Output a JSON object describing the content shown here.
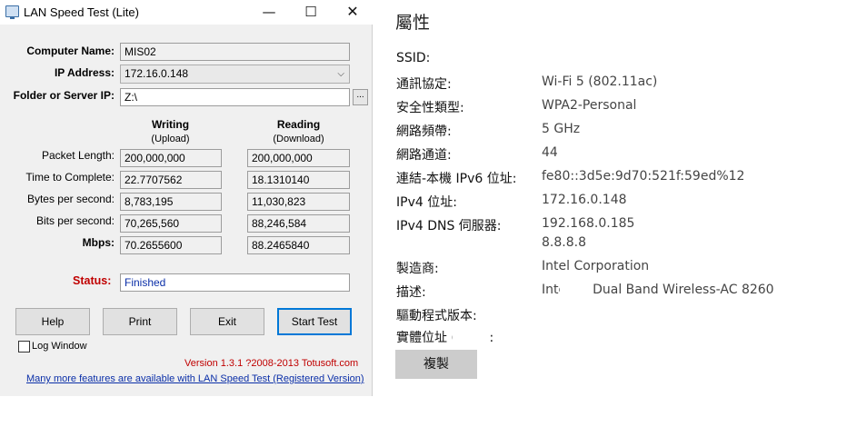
{
  "window": {
    "title": "LAN Speed Test (Lite)",
    "minimize_glyph": "—",
    "maximize_glyph": "☐",
    "close_glyph": "✕"
  },
  "form": {
    "computer_name_label": "Computer Name:",
    "computer_name_value": "MIS02",
    "ip_label": "IP Address:",
    "ip_value": "172.16.0.148",
    "folder_label": "Folder or Server IP:",
    "folder_value": "Z:\\",
    "browse_label": "..."
  },
  "columns": {
    "writing": "Writing",
    "writing_sub": "(Upload)",
    "reading": "Reading",
    "reading_sub": "(Download)"
  },
  "metrics": [
    {
      "label": "Packet Length:",
      "writing": "200,000,000",
      "reading": "200,000,000"
    },
    {
      "label": "Time to Complete:",
      "writing": "22.7707562",
      "reading": "18.1310140"
    },
    {
      "label": "Bytes per second:",
      "writing": "8,783,195",
      "reading": "11,030,823"
    },
    {
      "label": "Bits per second:",
      "writing": "70,265,560",
      "reading": "88,246,584"
    },
    {
      "label": "Mbps:",
      "writing": "70.2655600",
      "reading": "88.2465840"
    }
  ],
  "status": {
    "label": "Status:",
    "value": "Finished"
  },
  "buttons": {
    "help": "Help",
    "print": "Print",
    "exit": "Exit",
    "start": "Start Test"
  },
  "log_window_label": "Log Window",
  "version_text": "Version 1.3.1 ?2008-2013 Totusoft.com",
  "promo_link": "Many more features are available with LAN Speed Test (Registered Version)",
  "properties": {
    "title": "屬性",
    "rows": [
      {
        "key": "SSID:",
        "value": ""
      },
      {
        "key": "通訊協定:",
        "value": "Wi-Fi 5 (802.11ac)"
      },
      {
        "key": "安全性類型:",
        "value": "WPA2-Personal"
      },
      {
        "key": "網路頻帶:",
        "value": "5 GHz"
      },
      {
        "key": "網路通道:",
        "value": "44"
      },
      {
        "key": "連結-本機 IPv6 位址:",
        "value": "fe80::3d5e:9d70:521f:59ed%12"
      },
      {
        "key": "IPv4 位址:",
        "value": "172.16.0.148"
      },
      {
        "key": "IPv4 DNS 伺服器:",
        "value": "192.168.0.185",
        "value2": "8.8.8.8"
      },
      {
        "key": "製造商:",
        "value": "Intel Corporation"
      },
      {
        "key": "描述:",
        "value": "Intel(R) Dual Band Wireless-AC 8260"
      },
      {
        "key": "驅動程式版本:",
        "value": ""
      },
      {
        "key": "實體位址 (MAC):",
        "value": ""
      }
    ],
    "copy_label": "複製"
  }
}
